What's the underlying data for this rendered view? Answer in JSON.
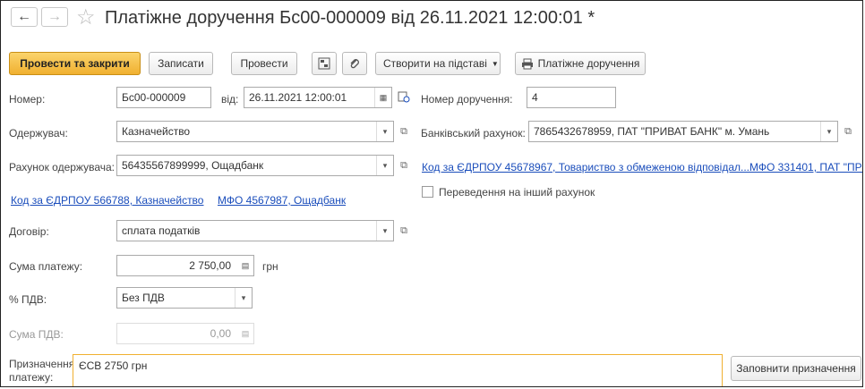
{
  "window": {
    "title": "Платіжне доручення Бс00-000009 від 26.11.2021 12:00:01 *",
    "back_icon": "←",
    "forward_icon": "→",
    "star_icon": "☆"
  },
  "toolbar": {
    "post_close": "Провести та закрити",
    "save": "Записати",
    "post": "Провести",
    "create_basis": "Створити на підставі",
    "print_order": "Платіжне доручення"
  },
  "form": {
    "number_label": "Номер:",
    "number_value": "Бс00-000009",
    "date_label": "від:",
    "date_value": "26.11.2021 12:00:01",
    "order_no_label": "Номер доручення:",
    "order_no_value": "4",
    "recipient_label": "Одержувач:",
    "recipient_value": "Казначейство",
    "bank_account_label": "Банківський рахунок:",
    "bank_account_value": "7865432678959, ПАТ \"ПРИВАТ БАНК\" м. Умань",
    "recipient_account_label": "Рахунок одержувача:",
    "recipient_account_value": "56435567899999, Ощадбанк",
    "own_edrpou_link": "Код за ЄДРПОУ 45678967, Товариство з обмеженою відповідал...",
    "own_mfo_link": "МФО 331401, ПАТ \"ПРИ",
    "recipient_edrpou_link": "Код за ЄДРПОУ 566788, Казначейство",
    "recipient_mfo_link": "МФО 4567987, Ощадбанк",
    "transfer_other_label": "Переведення на інший рахунок",
    "contract_label": "Договір:",
    "contract_value": "сплата податків",
    "amount_label": "Сума платежу:",
    "amount_value": "2 750,00",
    "currency": "грн",
    "vat_rate_label": "% ПДВ:",
    "vat_rate_value": "Без ПДВ",
    "vat_amount_label": "Сума ПДВ:",
    "vat_amount_value": "0,00",
    "purpose_label": "Призначення платежу:",
    "purpose_value": "ЄСВ 2750 грн",
    "fill_purpose": "Заповнити призначення"
  }
}
